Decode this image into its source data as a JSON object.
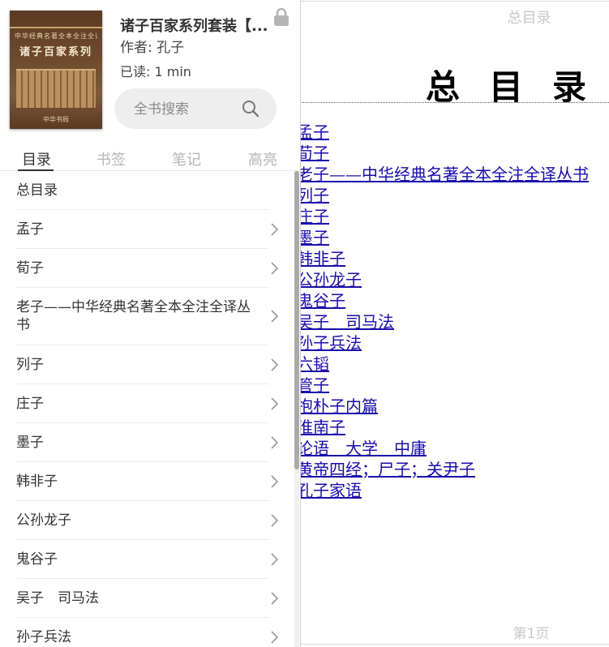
{
  "reader": {
    "header_title": "总目录",
    "big_title": "总目录",
    "links": [
      "孟子",
      "荀子",
      "老子——中华经典名著全本全注全译丛书",
      "列子",
      "庄子",
      "墨子",
      "韩非子",
      "公孙龙子",
      "鬼谷子",
      "吴子　司马法",
      "孙子兵法",
      "六韬",
      "管子",
      "抱朴子内篇",
      "淮南子",
      "论语　大学　中庸",
      "黄帝四经；尸子；关尹子",
      "孔子家语"
    ],
    "page_number": "第1页"
  },
  "book": {
    "title": "诸子百家系列套装【...",
    "author": "作者: 孔子",
    "progress": "已读: 1  min",
    "cover_title": "诸子百家系列",
    "cover_subtitle": "中华经典名著全本全注全译丛书",
    "cover_publisher": "中华书局"
  },
  "search": {
    "placeholder": "全书搜索"
  },
  "tabs": [
    {
      "label": "目录",
      "active": true
    },
    {
      "label": "书签",
      "active": false
    },
    {
      "label": "笔记",
      "active": false
    },
    {
      "label": "高亮",
      "active": false
    }
  ],
  "toc": [
    {
      "label": "总目录",
      "has_children": false
    },
    {
      "label": "孟子",
      "has_children": true
    },
    {
      "label": "荀子",
      "has_children": true
    },
    {
      "label": "老子——中华经典名著全本全注全译丛书",
      "has_children": true
    },
    {
      "label": "列子",
      "has_children": true
    },
    {
      "label": "庄子",
      "has_children": true
    },
    {
      "label": "墨子",
      "has_children": true
    },
    {
      "label": "韩非子",
      "has_children": true
    },
    {
      "label": "公孙龙子",
      "has_children": true
    },
    {
      "label": "鬼谷子",
      "has_children": true
    },
    {
      "label": "吴子　司马法",
      "has_children": true
    },
    {
      "label": "孙子兵法",
      "has_children": true
    }
  ],
  "icons": {
    "lock": "lock-icon",
    "search": "search-icon",
    "chevron": "chevron-right-icon"
  },
  "colors": {
    "link": "#1a0dab",
    "active_tab": "#333333",
    "inactive_tab": "#b5b5b5",
    "search_bg": "#eeeeee"
  }
}
